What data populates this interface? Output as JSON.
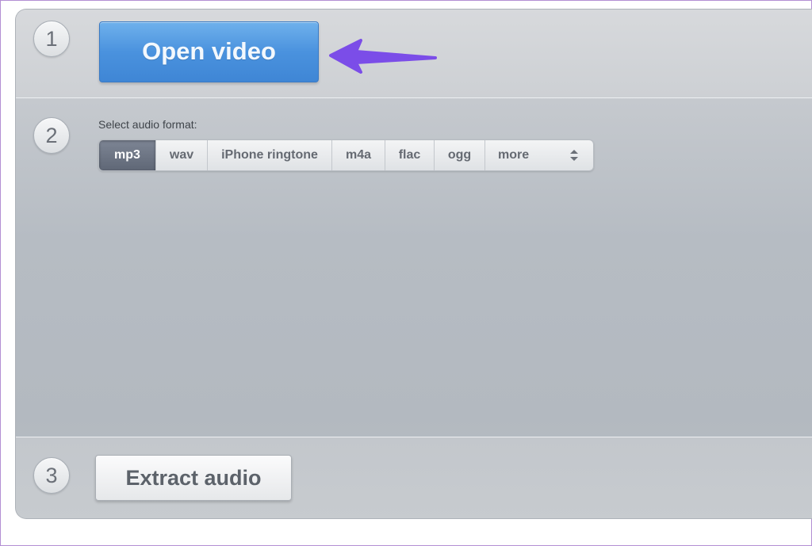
{
  "steps": [
    {
      "number": "1"
    },
    {
      "number": "2"
    },
    {
      "number": "3"
    }
  ],
  "step1": {
    "open_button_label": "Open video"
  },
  "step2": {
    "label": "Select audio format:",
    "formats": [
      {
        "label": "mp3",
        "active": true
      },
      {
        "label": "wav"
      },
      {
        "label": "iPhone ringtone"
      },
      {
        "label": "m4a"
      },
      {
        "label": "flac"
      },
      {
        "label": "ogg"
      },
      {
        "label": "more"
      }
    ]
  },
  "step3": {
    "extract_button_label": "Extract audio"
  },
  "colors": {
    "accent_blue": "#4a92de",
    "arrow_purple": "#7b4de8",
    "active_format": "#6b7382"
  },
  "icons": {
    "pointer_arrow": "arrow-left-icon",
    "more_selector": "updown-chevron-icon"
  }
}
